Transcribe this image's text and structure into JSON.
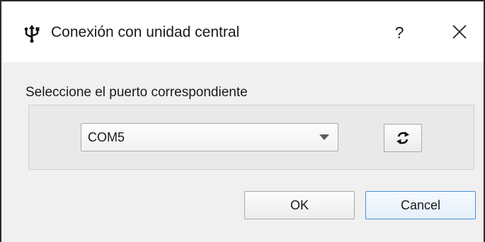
{
  "window": {
    "title": "Conexión con unidad central",
    "app_icon": "usb-icon",
    "help_label": "?",
    "close_icon": "close-icon"
  },
  "form": {
    "prompt": "Seleccione el puerto correspondiente",
    "port_select": {
      "selected_value": "COM5"
    },
    "refresh_icon": "refresh-icon"
  },
  "buttons": {
    "ok_label": "OK",
    "cancel_label": "Cancel"
  },
  "colors": {
    "focus_border": "#4a90d6",
    "dialog_background": "#f0f0f0"
  }
}
